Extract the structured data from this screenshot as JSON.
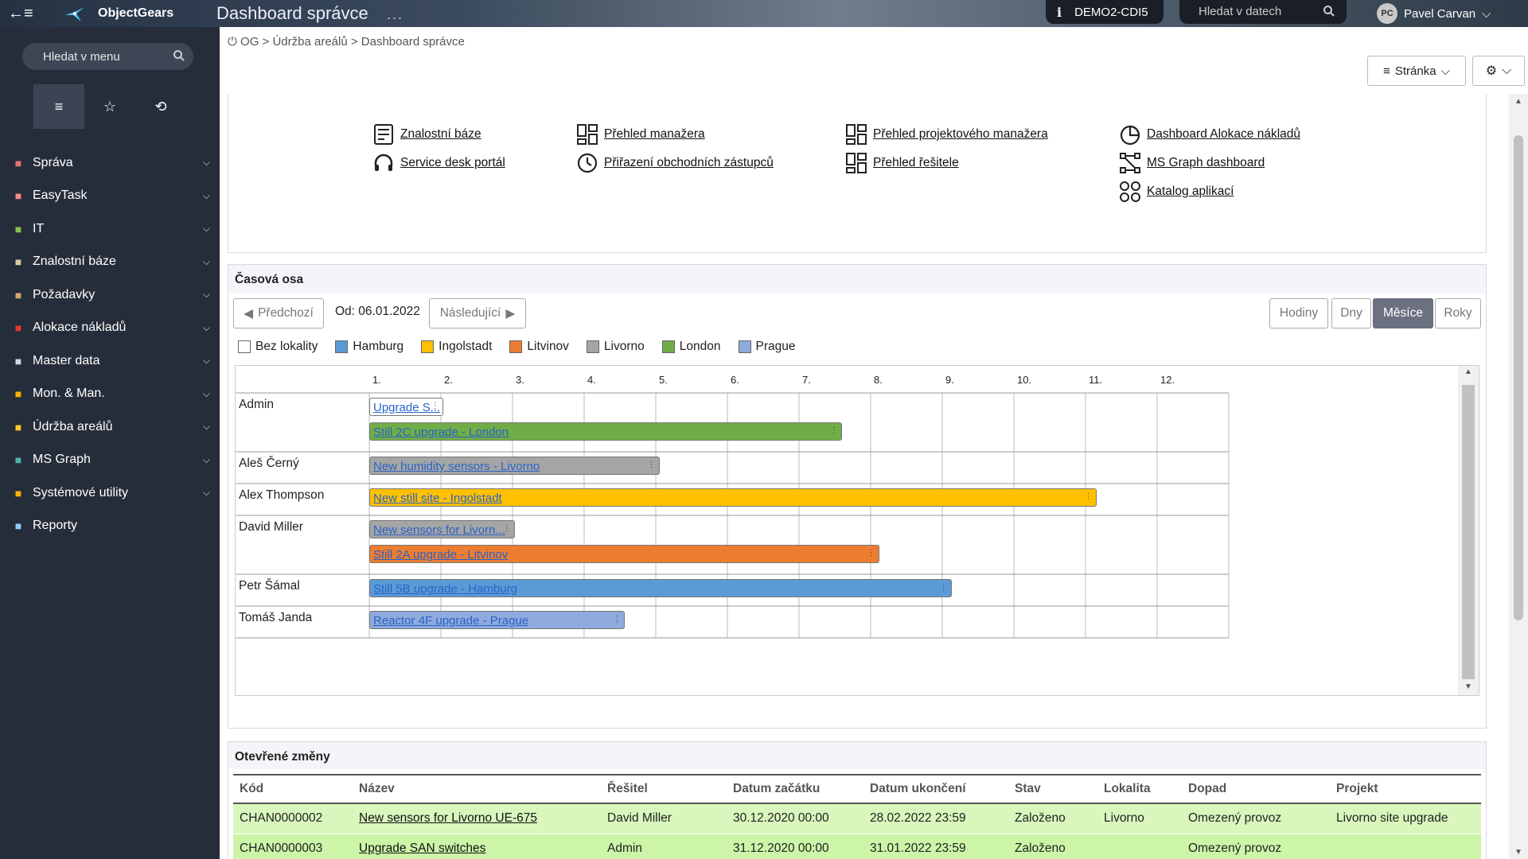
{
  "topbar": {
    "brand": "ObjectGears",
    "page_title": "Dashboard správce",
    "dots": "...",
    "env_name": "DEMO2-CDI5",
    "search_placeholder": "Hledat v datech",
    "user_initials": "PC",
    "user_name": "Pavel Carvan"
  },
  "sidebar": {
    "search_placeholder": "Hledat v menu",
    "items": [
      {
        "label": "Správa",
        "icon": "tools-icon",
        "color": "#e57373"
      },
      {
        "label": "EasyTask",
        "icon": "eraser-icon",
        "color": "#f28b82"
      },
      {
        "label": "IT",
        "icon": "cube-icon",
        "color": "#8bc34a"
      },
      {
        "label": "Znalostní báze",
        "icon": "book-icon",
        "color": "#e0c9a6"
      },
      {
        "label": "Požadavky",
        "icon": "basket-icon",
        "color": "#d4a76a"
      },
      {
        "label": "Alokace nákladů",
        "icon": "grid-icon",
        "color": "#e53935"
      },
      {
        "label": "Master data",
        "icon": "stack-icon",
        "color": "#cfd8dc"
      },
      {
        "label": "Mon. & Man.",
        "icon": "magnifier-icon",
        "color": "#ffb300"
      },
      {
        "label": "Údržba areálů",
        "icon": "wrench-icon",
        "color": "#ffca28"
      },
      {
        "label": "MS Graph",
        "icon": "graph-icon",
        "color": "#4db6ac"
      },
      {
        "label": "Systémové utility",
        "icon": "key-icon",
        "color": "#ffb300"
      },
      {
        "label": "Reporty",
        "icon": "report-icon",
        "color": "#90caf9"
      }
    ]
  },
  "breadcrumb": "OG > Údržba areálů > Dashboard správce",
  "page_button": "Stránka",
  "links": [
    {
      "label": "Znalostní báze",
      "icon": "list-doc-icon"
    },
    {
      "label": "Service desk portál",
      "icon": "headset-icon"
    },
    {
      "label": "Přehled manažera",
      "icon": "dashboard-grid-icon"
    },
    {
      "label": "Přiřazení obchodních zástupců",
      "icon": "clock-icon"
    },
    {
      "label": "Přehled projektového manažera",
      "icon": "dashboard-grid-icon"
    },
    {
      "label": "Přehled řešitele",
      "icon": "dashboard-grid-icon"
    },
    {
      "label": "Dashboard Alokace nákladů",
      "icon": "pie-icon"
    },
    {
      "label": "MS Graph dashboard",
      "icon": "graph-nodes-icon"
    },
    {
      "label": "Katalog aplikací",
      "icon": "apps-icon"
    }
  ],
  "timeline": {
    "title": "Časová osa",
    "prev": "Předchozí",
    "from": "Od: 06.01.2022",
    "next": "Následující",
    "views": [
      "Hodiny",
      "Dny",
      "Měsíce",
      "Roky"
    ],
    "active_view": "Měsíce",
    "legend": [
      {
        "label": "Bez lokality",
        "color": "#ffffff"
      },
      {
        "label": "Hamburg",
        "color": "#5b9bd5"
      },
      {
        "label": "Ingolstadt",
        "color": "#ffc000"
      },
      {
        "label": "Litvinov",
        "color": "#ed7d31"
      },
      {
        "label": "Livorno",
        "color": "#a5a5a5"
      },
      {
        "label": "London",
        "color": "#70ad47"
      },
      {
        "label": "Prague",
        "color": "#8faadc"
      }
    ],
    "months": [
      "1.",
      "2.",
      "3.",
      "4.",
      "5.",
      "6.",
      "7.",
      "8.",
      "9.",
      "10.",
      "11.",
      "12."
    ],
    "rows": [
      {
        "name": "Admin",
        "tasks": [
          {
            "label": "Upgrade S...",
            "color": "#ffffff",
            "start_month": 0,
            "end_month": 1.03
          },
          {
            "label": "Still 2C upgrade - London",
            "color": "#70ad47",
            "start_month": 0,
            "end_month": 6.6
          }
        ]
      },
      {
        "name": "Aleš Černý",
        "tasks": [
          {
            "label": "New humidity sensors - Livorno",
            "color": "#a5a5a5",
            "start_month": 0,
            "end_month": 4.05
          }
        ]
      },
      {
        "name": "Alex Thompson",
        "tasks": [
          {
            "label": "New still site - Ingolstadt",
            "color": "#ffc000",
            "start_month": 0,
            "end_month": 10.15
          }
        ]
      },
      {
        "name": "David Miller",
        "tasks": [
          {
            "label": "New sensors for Livorn...",
            "color": "#a5a5a5",
            "start_month": 0,
            "end_month": 2.03
          },
          {
            "label": "Still 2A upgrade - Litvinov",
            "color": "#ed7d31",
            "start_month": 0,
            "end_month": 7.12
          }
        ]
      },
      {
        "name": "Petr Šámal",
        "tasks": [
          {
            "label": "Still 5B upgrade - Hamburg",
            "color": "#5b9bd5",
            "start_month": 0,
            "end_month": 8.13
          }
        ]
      },
      {
        "name": "Tomáš Janda",
        "tasks": [
          {
            "label": "Reactor 4F upgrade - Prague",
            "color": "#8faadc",
            "start_month": 0,
            "end_month": 3.57
          }
        ]
      }
    ]
  },
  "changes": {
    "title": "Otevřené změny",
    "columns": [
      "Kód",
      "Název",
      "Řešitel",
      "Datum začátku",
      "Datum ukončení",
      "Stav",
      "Lokalita",
      "Dopad",
      "Projekt"
    ],
    "rows": [
      [
        "CHAN0000002",
        "New sensors for Livorno UE-675",
        "David Miller",
        "30.12.2020 00:00",
        "28.02.2022 23:59",
        "Založeno",
        "Livorno",
        "Omezený provoz",
        "Livorno site upgrade"
      ],
      [
        "CHAN0000003",
        "Upgrade SAN switches",
        "Admin",
        "31.12.2020 00:00",
        "31.01.2022 23:59",
        "Založeno",
        "",
        "Omezený provoz",
        ""
      ]
    ]
  }
}
